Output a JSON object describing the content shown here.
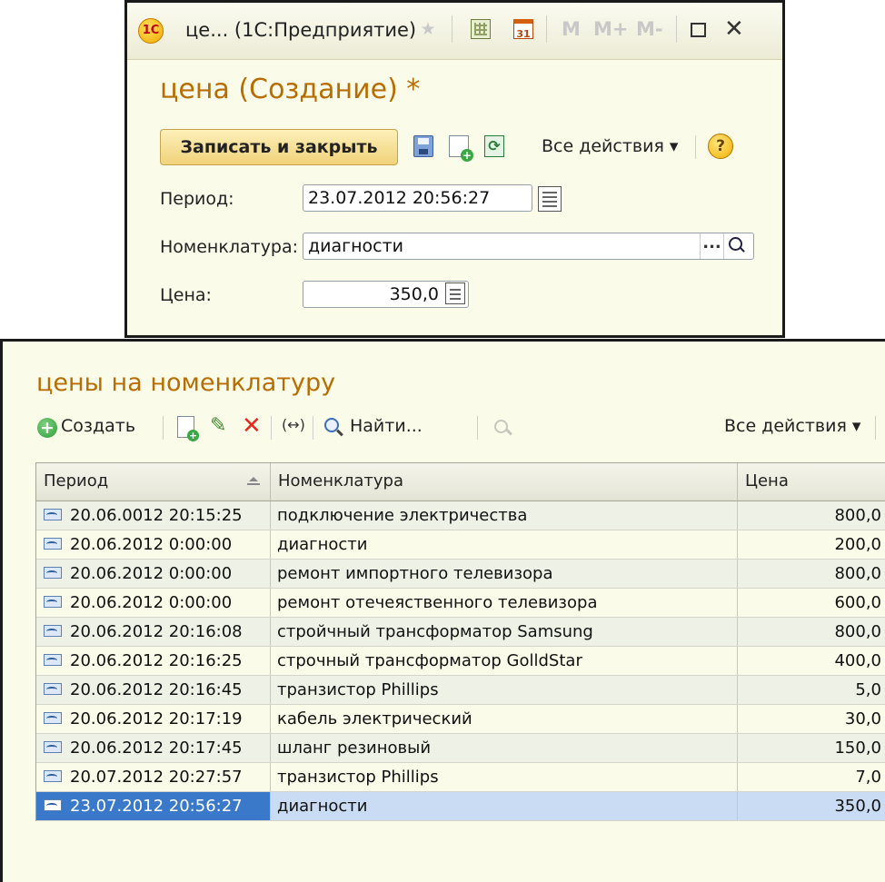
{
  "dialog": {
    "window_title": "це...  (1С:Предприятие)",
    "logo_text": "1С",
    "calendar_day": "31",
    "memory_buttons": [
      "M",
      "M+",
      "M-"
    ],
    "form_title": "цена (Создание) *",
    "save_button": "Записать и закрыть",
    "all_actions": "Все действия ▾",
    "help": "?",
    "fields": {
      "period_label": "Период:",
      "period_value": "23.07.2012 20:56:27",
      "item_label": "Номенклатура:",
      "item_value": "диагности",
      "price_label": "Цена:",
      "price_value": "350,0",
      "choose_button": "..."
    },
    "icons": [
      "favorites-star-icon",
      "calculator-icon",
      "calendar-icon",
      "maximize-icon",
      "close-icon",
      "save-icon",
      "copy-new-icon",
      "refresh-icon",
      "help-icon",
      "calendar-picker-icon",
      "search-icon"
    ]
  },
  "list": {
    "title": "цены на номенклатуру",
    "toolbar": {
      "create": "Создать",
      "find": "Найти...",
      "all_actions": "Все действия ▾",
      "arrows": "(↔)"
    },
    "columns": [
      "Период",
      "Номенклатура",
      "Цена"
    ],
    "rows": [
      {
        "period": "20.06.0012 20:15:25",
        "item": "подключение электричества",
        "price": "800,0"
      },
      {
        "period": "20.06.2012 0:00:00",
        "item": "диагности",
        "price": "200,0"
      },
      {
        "period": "20.06.2012 0:00:00",
        "item": "ремонт импортного телевизора",
        "price": "800,0"
      },
      {
        "period": "20.06.2012 0:00:00",
        "item": "ремонт отечеяственного телевизора",
        "price": "600,0"
      },
      {
        "period": "20.06.2012 20:16:08",
        "item": "стройчный трансформатор Samsung",
        "price": "800,0"
      },
      {
        "period": "20.06.2012 20:16:25",
        "item": "строчный трансформатор GolldStar",
        "price": "400,0"
      },
      {
        "period": "20.06.2012 20:16:45",
        "item": "транзистор Phillips",
        "price": "5,0"
      },
      {
        "period": "20.06.2012 20:17:19",
        "item": "кабель электрический",
        "price": "30,0"
      },
      {
        "period": "20.06.2012 20:17:45",
        "item": "шланг резиновый",
        "price": "150,0"
      },
      {
        "period": "20.07.2012 20:27:57",
        "item": "транзистор Phillips",
        "price": "7,0"
      },
      {
        "period": "23.07.2012 20:56:27",
        "item": "диагности",
        "price": "350,0"
      }
    ],
    "selected_row": 10
  },
  "colors": {
    "accent_title": "#b76d00",
    "selection": "#3a78c9",
    "window_bg": "#fbfbe9"
  }
}
